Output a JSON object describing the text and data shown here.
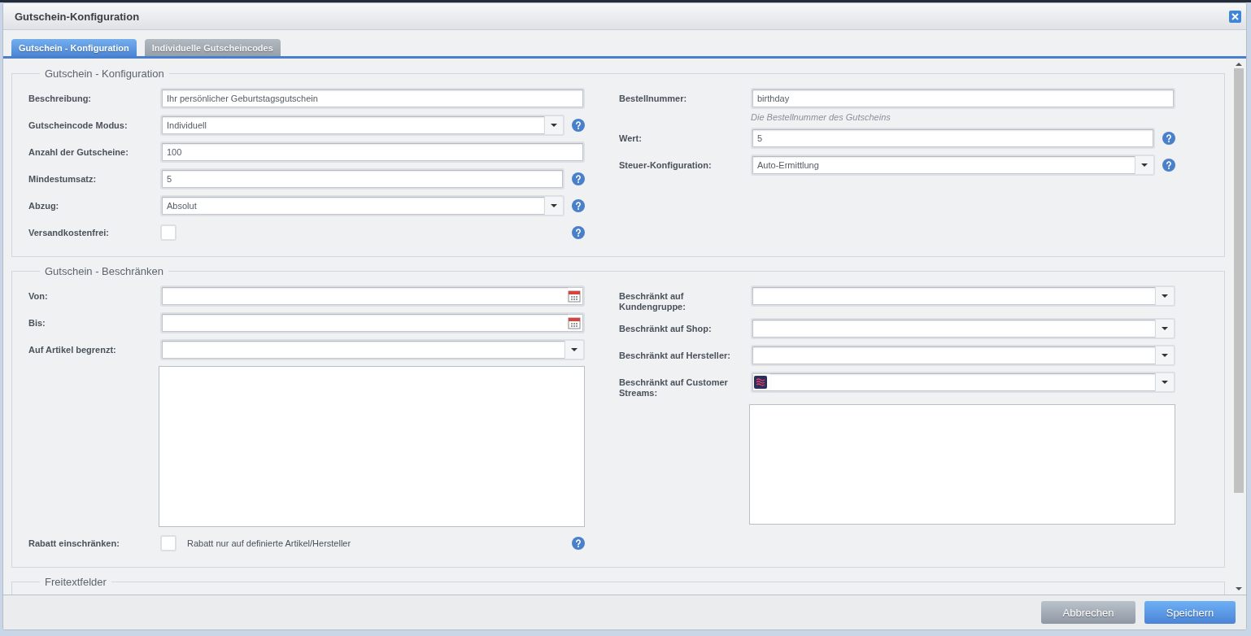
{
  "window": {
    "title": "Gutschein-Konfiguration"
  },
  "tabs": [
    {
      "label": "Gutschein - Konfiguration",
      "selected": true
    },
    {
      "label": "Individuelle Gutscheincodes",
      "selected": false
    }
  ],
  "sections": [
    {
      "legend": "Gutschein - Konfiguration",
      "left": [
        {
          "label": "Beschreibung:",
          "kind": "text",
          "value": "Ihr persönlicher Geburtstagsgutschein",
          "help": false
        },
        {
          "label": "Gutscheincode Modus:",
          "kind": "select",
          "value": "Individuell",
          "help": true
        },
        {
          "label": "Anzahl der Gutscheine:",
          "kind": "text",
          "value": "100",
          "help": false
        },
        {
          "label": "Mindestumsatz:",
          "kind": "text",
          "value": "5",
          "help": true
        },
        {
          "label": "Abzug:",
          "kind": "select",
          "value": "Absolut",
          "help": true
        },
        {
          "label": "Versandkostenfrei:",
          "kind": "checkbox",
          "checked": false,
          "help": true
        }
      ],
      "right": [
        {
          "label": "Bestellnummer:",
          "kind": "text",
          "value": "birthday",
          "hint": "Die Bestellnummer des Gutscheins",
          "help": false
        },
        {
          "label": "Wert:",
          "kind": "text",
          "value": "5",
          "help": true
        },
        {
          "label": "Steuer-Konfiguration:",
          "kind": "select",
          "value": "Auto-Ermittlung",
          "help": true
        }
      ]
    },
    {
      "legend": "Gutschein - Beschränken",
      "left": [
        {
          "label": "Von:",
          "kind": "date",
          "help": false
        },
        {
          "label": "Bis:",
          "kind": "date",
          "help": false
        },
        {
          "label": "Auf Artikel begrenzt:",
          "kind": "select",
          "help": false
        },
        {
          "kind": "list"
        },
        {
          "label": "Rabatt einschränken:",
          "kind": "checkbox",
          "checked": false,
          "text": "Rabatt nur auf definierte Artikel/Hersteller",
          "help": true
        }
      ],
      "right": [
        {
          "label": "Beschränkt auf Kundengruppe:",
          "kind": "select",
          "help": false
        },
        {
          "label": "Beschränkt auf Shop:",
          "kind": "select",
          "help": false
        },
        {
          "label": "Beschränkt auf Hersteller:",
          "kind": "select",
          "help": false
        },
        {
          "label": "Beschränkt auf Customer Streams:",
          "kind": "icon-select",
          "help": false
        },
        {
          "kind": "list"
        }
      ]
    },
    {
      "legend": "Freitextfelder"
    }
  ],
  "buttons": [
    {
      "label": "Abbrechen",
      "kind": "secondary"
    },
    {
      "label": "Speichern",
      "kind": "primary"
    }
  ]
}
